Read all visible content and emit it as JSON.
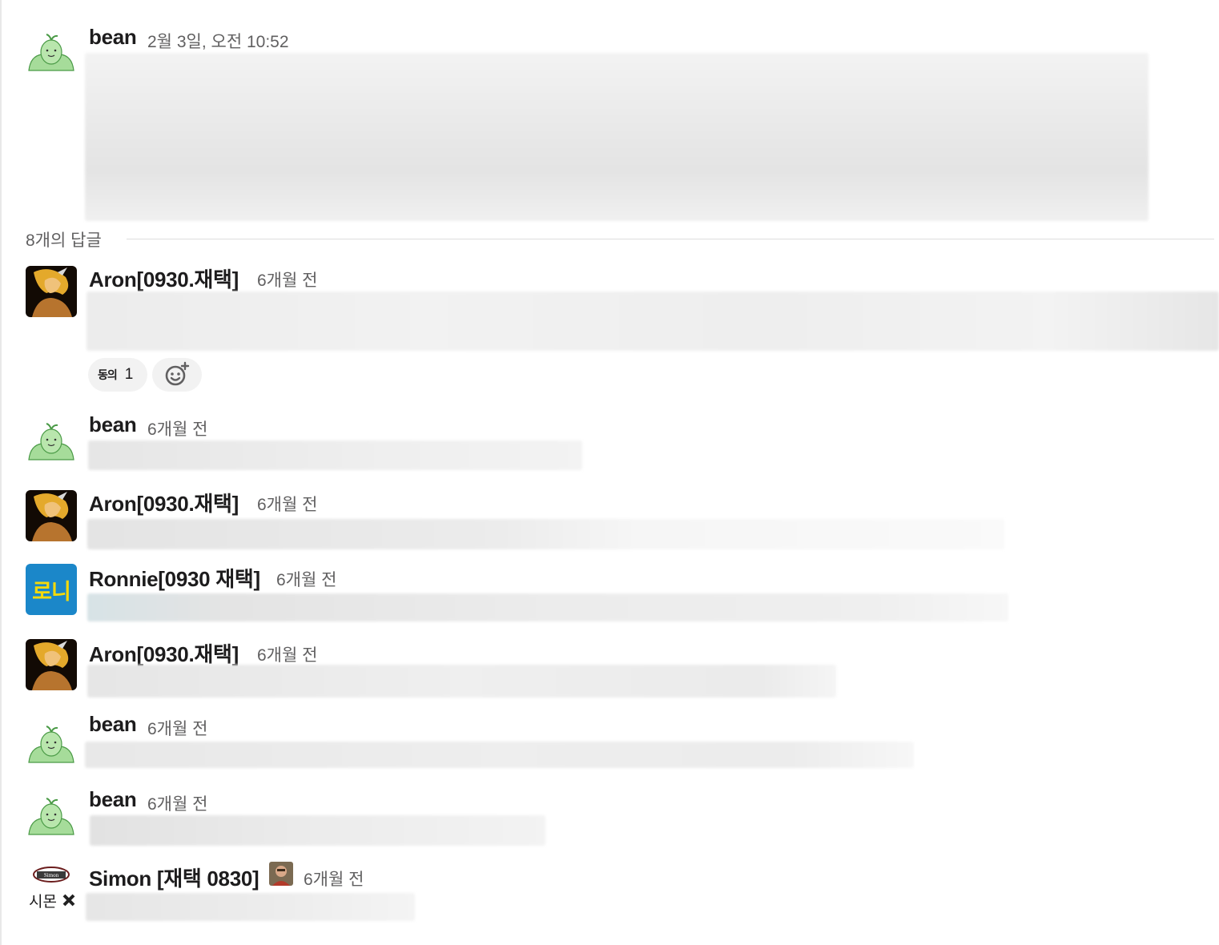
{
  "thread": {
    "parent": {
      "author": "bean",
      "timestamp": "2월 3일, 오전 10:52"
    },
    "replies_label": "8개의 답글",
    "replies": [
      {
        "author": "Aron[0930.재택]",
        "timestamp": "6개월 전",
        "avatar": "aron"
      },
      {
        "author": "bean",
        "timestamp": "6개월 전",
        "avatar": "bean"
      },
      {
        "author": "Aron[0930.재택]",
        "timestamp": "6개월 전",
        "avatar": "aron"
      },
      {
        "author": "Ronnie[0930 재택]",
        "timestamp": "6개월 전",
        "avatar": "ronnie"
      },
      {
        "author": "Aron[0930.재택]",
        "timestamp": "6개월 전",
        "avatar": "aron"
      },
      {
        "author": "bean",
        "timestamp": "6개월 전",
        "avatar": "bean"
      },
      {
        "author": "bean",
        "timestamp": "6개월 전",
        "avatar": "bean"
      },
      {
        "author": "Simon [재택 0830]",
        "timestamp": "6개월 전",
        "avatar": "simon"
      }
    ]
  },
  "reaction": {
    "emoji_text": "동의",
    "count": "1"
  },
  "add_reaction_icon": "add-emoji-icon",
  "avatars": {
    "ronnie_text": "로니",
    "simon_badge": "Simon",
    "simon_text": "시몬"
  },
  "colors": {
    "ronnie_bg": "#1b87c9",
    "ronnie_fg": "#f5d90a",
    "bean_green": "#a6dc9a",
    "timestamp": "#616061"
  }
}
